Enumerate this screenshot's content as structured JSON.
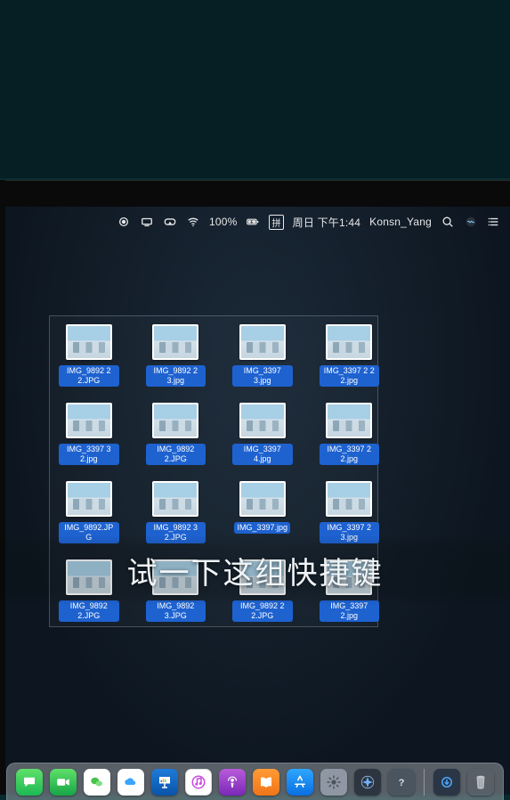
{
  "menubar": {
    "record_indicator": "●",
    "vr_icon": "vr-icon",
    "wifi_icon": "wifi-icon",
    "battery_text": "100%",
    "battery_icon": "battery-icon",
    "input_method": "拼",
    "datetime": "周日 下午1:44",
    "username": "Konsn_Yang",
    "search_icon": "search-icon",
    "siri_icon": "siri-icon",
    "control_icon": "list-icon"
  },
  "desktop": {
    "rows": [
      [
        {
          "name": "IMG_9892 2 2.JPG"
        },
        {
          "name": "IMG_9892 2 3.jpg"
        },
        {
          "name": "IMG_3397 3.jpg"
        },
        {
          "name": "IMG_3397 2 2 2.jpg"
        }
      ],
      [
        {
          "name": "IMG_3397 3 2.jpg"
        },
        {
          "name": "IMG_9892 2.JPG"
        },
        {
          "name": "IMG_3397 4.jpg"
        },
        {
          "name": "IMG_3397 2 2.jpg"
        }
      ],
      [
        {
          "name": "IMG_9892.JPG"
        },
        {
          "name": "IMG_9892 3 2.JPG"
        },
        {
          "name": "IMG_3397.jpg"
        },
        {
          "name": "IMG_3397 2 3.jpg"
        }
      ],
      [
        {
          "name": "IMG_9892 2.JPG"
        },
        {
          "name": "IMG_9892 3.JPG"
        },
        {
          "name": "IMG_9892 2 2.JPG"
        },
        {
          "name": "IMG_3397 2.jpg"
        }
      ]
    ]
  },
  "subtitle": "试一下这组快捷键",
  "dock": {
    "apps": [
      {
        "id": "messages",
        "label": "信息"
      },
      {
        "id": "facetime",
        "label": "FaceTime"
      },
      {
        "id": "wechat",
        "label": "WeChat"
      },
      {
        "id": "icloud",
        "label": "iCloud"
      },
      {
        "id": "keynote",
        "label": "Keynote"
      },
      {
        "id": "itunes",
        "label": "iTunes"
      },
      {
        "id": "podcasts",
        "label": "播客"
      },
      {
        "id": "ibooks",
        "label": "图书"
      },
      {
        "id": "appstore",
        "label": "App Store"
      },
      {
        "id": "settings",
        "label": "系统偏好设置"
      },
      {
        "id": "safarialt",
        "label": "浏览器"
      },
      {
        "id": "help",
        "label": "帮助"
      }
    ],
    "right": [
      {
        "id": "downloads",
        "label": "下载"
      },
      {
        "id": "trash",
        "label": "废纸篓"
      }
    ]
  }
}
